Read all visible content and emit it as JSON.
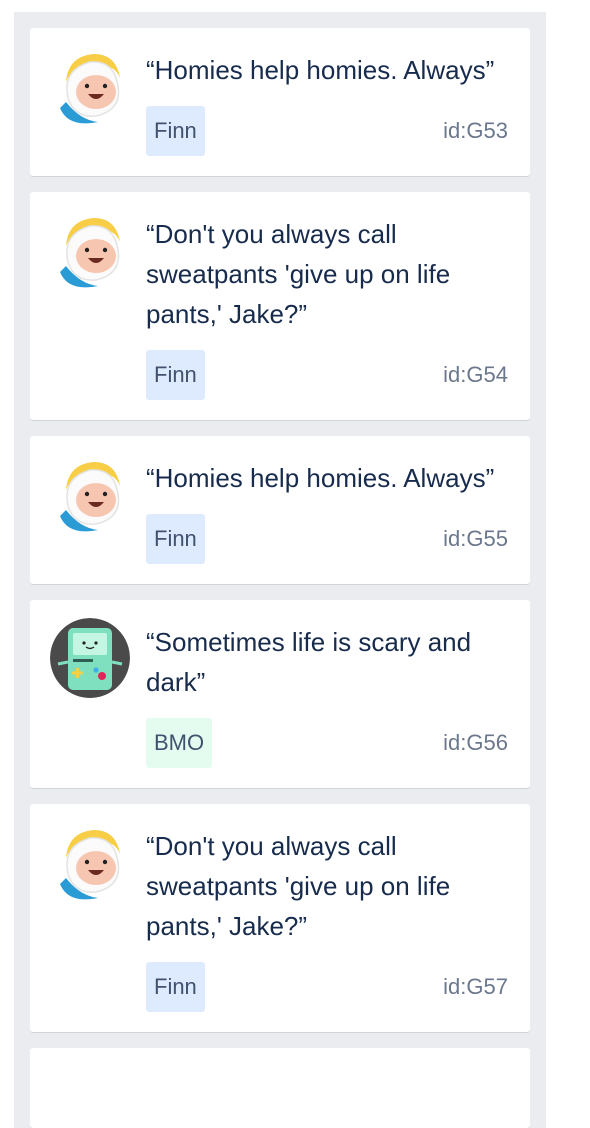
{
  "cards": [
    {
      "avatar": "finn-avatar",
      "quote": "“Homies help homies. Always”",
      "tag": "Finn",
      "tag_color": "#deebff",
      "id": "id:G53"
    },
    {
      "avatar": "finn-avatar",
      "quote": "“Don't you always call sweatpants 'give up on life pants,' Jake?”",
      "tag": "Finn",
      "tag_color": "#deebff",
      "id": "id:G54"
    },
    {
      "avatar": "finn-avatar",
      "quote": "“Homies help homies. Always”",
      "tag": "Finn",
      "tag_color": "#deebff",
      "id": "id:G55"
    },
    {
      "avatar": "bmo-avatar",
      "quote": "“Sometimes life is scary and dark”",
      "tag": "BMO",
      "tag_color": "#e3fcef",
      "id": "id:G56"
    },
    {
      "avatar": "finn-avatar",
      "quote": "“Don't you always call sweatpants 'give up on life pants,' Jake?”",
      "tag": "Finn",
      "tag_color": "#deebff",
      "id": "id:G57"
    }
  ],
  "colors": {
    "column_bg": "#ebecf0",
    "card_bg": "#ffffff",
    "quote_text": "#172b4d",
    "id_text": "#6b778c"
  }
}
